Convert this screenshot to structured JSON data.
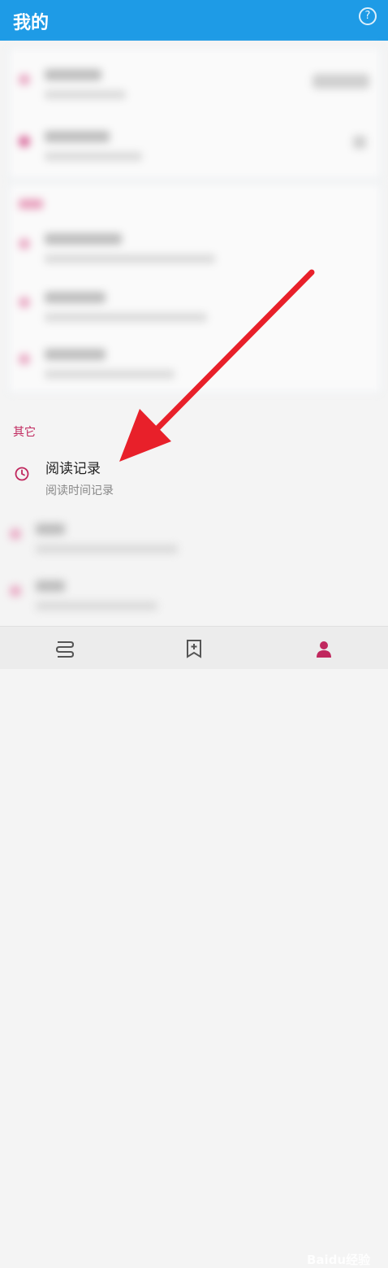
{
  "header": {
    "title": "我的",
    "help_icon": "help-circle-icon",
    "color": "#1e9be6"
  },
  "others": {
    "section_title": "其它",
    "accent": "#c0285e",
    "history": {
      "label": "阅读记录",
      "sub": "阅读时间记录",
      "icon": "clock-icon"
    }
  },
  "bottom_nav": {
    "items": [
      "bookshelf-icon",
      "bookmark-add-icon",
      "profile-icon"
    ]
  },
  "watermark": "Baidu经验"
}
